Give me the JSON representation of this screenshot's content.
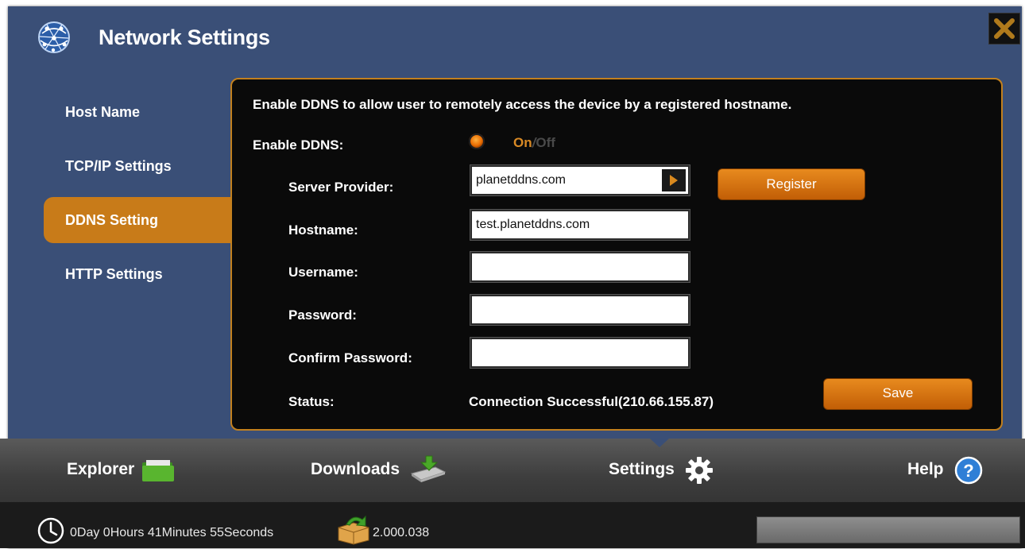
{
  "window": {
    "title": "Network Settings",
    "icons": {
      "app": "globe-network-icon",
      "close": "close-icon"
    }
  },
  "sidebar": {
    "items": [
      {
        "label": "Host Name",
        "active": false
      },
      {
        "label": "TCP/IP Settings",
        "active": false
      },
      {
        "label": "DDNS Setting",
        "active": true
      },
      {
        "label": "HTTP Settings",
        "active": false
      }
    ]
  },
  "ddns": {
    "intro": "Enable DDNS to allow user to remotely access the device by a registered hostname.",
    "enable_label": "Enable DDNS:",
    "toggle": {
      "on": "On",
      "separator": "/",
      "off": "Off",
      "state": "on"
    },
    "server_provider_label": "Server Provider:",
    "server_provider_value": "planetddns.com",
    "register_label": "Register",
    "hostname_label": "Hostname:",
    "hostname_value": "test.planetddns.com",
    "username_label": "Username:",
    "username_value": "",
    "password_label": "Password:",
    "password_value": "",
    "confirm_password_label": "Confirm Password:",
    "confirm_password_value": "",
    "status_label": "Status:",
    "status_value": "Connection Successful(210.66.155.87)",
    "save_label": "Save"
  },
  "tabs": [
    {
      "label": "Explorer",
      "icon": "folder-icon"
    },
    {
      "label": "Downloads",
      "icon": "download-icon"
    },
    {
      "label": "Settings",
      "icon": "gear-icon",
      "active": true
    },
    {
      "label": "Help",
      "icon": "help-icon"
    }
  ],
  "statusbar": {
    "uptime": "0Day 0Hours 41Minutes 55Seconds",
    "uptime_icon": "clock-icon",
    "version": "2.000.038",
    "version_icon": "package-icon"
  },
  "colors": {
    "background": "#3a4f77",
    "accent": "#c87b19",
    "panel": "#0a0a0a",
    "panel_border": "#c2801e"
  }
}
